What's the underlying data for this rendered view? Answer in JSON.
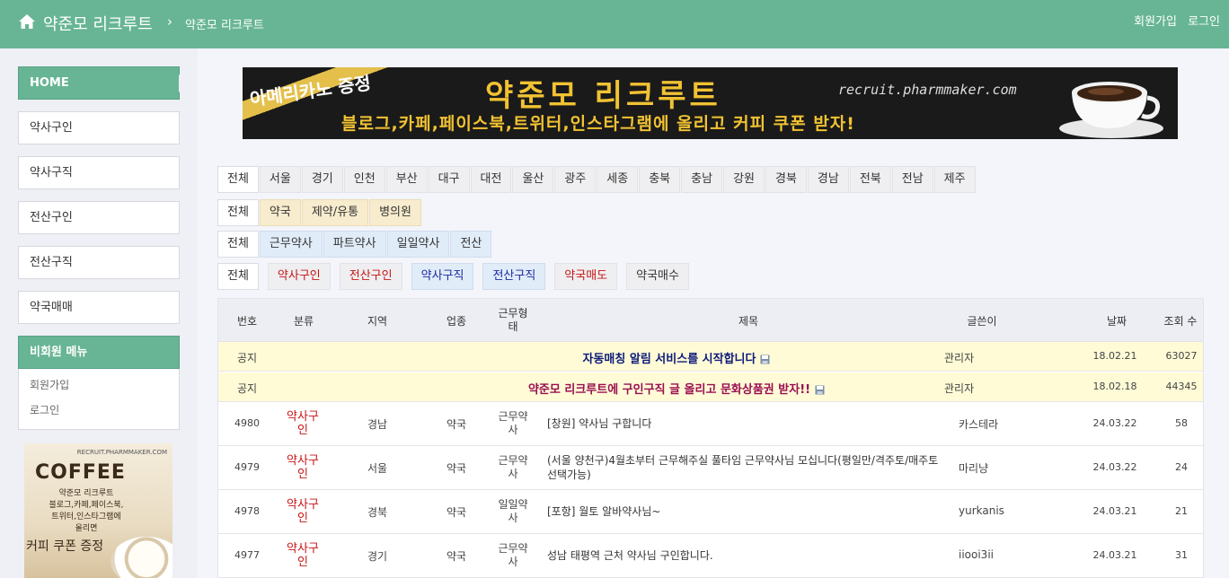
{
  "header": {
    "brand": "약준모 리크루트",
    "separator": "›",
    "crumb": "약준모 리크루트",
    "signup": "회원가입",
    "login": "로그인"
  },
  "sidebar": {
    "items": [
      "HOME",
      "약사구인",
      "약사구직",
      "전산구인",
      "전산구직",
      "약국매매"
    ],
    "guest_heading": "비회원 메뉴",
    "guest_links": [
      "회원가입",
      "로그인"
    ],
    "ad": {
      "site": "RECRUIT.PHARMMAKER.COM",
      "title": "COFFEE",
      "lines": [
        "약준모 리크루트",
        "블로그,카페,페이스북,",
        "트위터,인스타그램에",
        "올리면"
      ],
      "big": "커피 쿠폰 증정"
    }
  },
  "banner": {
    "promo": "아메리카노 증정",
    "main": "약준모 리크루트",
    "url": "recruit.pharmmaker.com",
    "sub": "블로그,카페,페이스북,트위터,인스타그램에 올리고 커피 쿠폰 받자!"
  },
  "filters": {
    "regions": [
      "전체",
      "서울",
      "경기",
      "인천",
      "부산",
      "대구",
      "대전",
      "울산",
      "광주",
      "세종",
      "충북",
      "충남",
      "강원",
      "경북",
      "경남",
      "전북",
      "전남",
      "제주"
    ],
    "business": [
      "전체",
      "약국",
      "제약/유통",
      "병의원"
    ],
    "work_type": [
      "전체",
      "근무약사",
      "파트약사",
      "일일약사",
      "전산"
    ],
    "category": [
      "전체",
      "약사구인",
      "전산구인",
      "약사구직",
      "전산구직",
      "약국매도",
      "약국매수"
    ]
  },
  "colors": {
    "accent": "#67b594",
    "category_red": "#c81515",
    "category_blue": "#1a2aa0",
    "notice_bg": "#fefbd6"
  },
  "table": {
    "headers": {
      "num": "번호",
      "category": "분류",
      "region": "지역",
      "business": "업종",
      "work_type": "근무형태",
      "title": "제목",
      "author": "글쓴이",
      "date": "날짜",
      "views": "조회 수"
    },
    "notices": [
      {
        "num": "공지",
        "title": "자동매칭 알림 서비스를 시작합니다",
        "author": "관리자",
        "date": "18.02.21",
        "views": "63027"
      },
      {
        "num": "공지",
        "title": "약준모 리크루트에 구인구직 글 올리고 문화상품권 받자!!",
        "author": "관리자",
        "date": "18.02.18",
        "views": "44345"
      }
    ],
    "rows": [
      {
        "num": "4980",
        "category": "약사구인",
        "region": "경남",
        "business": "약국",
        "work_type": "근무약사",
        "title": "[창원] 약사님 구합니다",
        "author": "카스테라",
        "date": "24.03.22",
        "views": "58"
      },
      {
        "num": "4979",
        "category": "약사구인",
        "region": "서울",
        "business": "약국",
        "work_type": "근무약사",
        "title": "(서울 양천구)4월초부터 근무해주실 풀타임 근무약사님 모십니다(평일만/격주토/매주토 선택가능)",
        "author": "마리냥",
        "date": "24.03.22",
        "views": "24"
      },
      {
        "num": "4978",
        "category": "약사구인",
        "region": "경북",
        "business": "약국",
        "work_type": "일일약사",
        "title": "[포항] 월토 알바약사님~",
        "author": "yurkanis",
        "date": "24.03.21",
        "views": "21"
      },
      {
        "num": "4977",
        "category": "약사구인",
        "region": "경기",
        "business": "약국",
        "work_type": "근무약사",
        "title": "성남 태평역 근처 약사님 구인합니다.",
        "author": "iiooi3ii",
        "date": "24.03.21",
        "views": "31"
      }
    ]
  }
}
